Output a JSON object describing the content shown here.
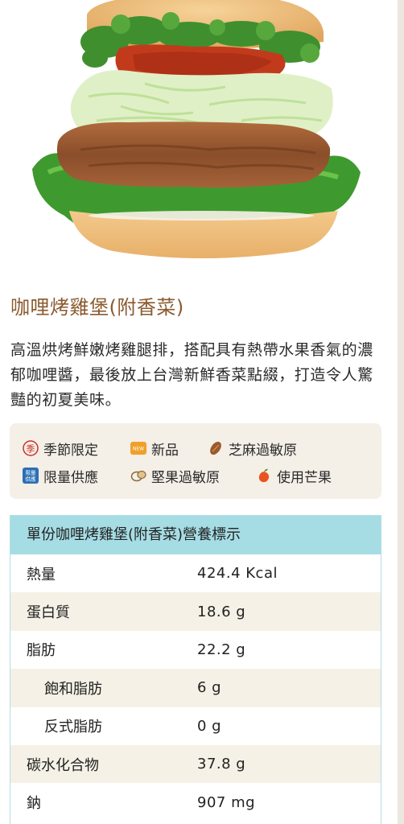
{
  "product": {
    "title": "咖哩烤雞堡(附香菜)",
    "description": "高溫烘烤鮮嫩烤雞腿排，搭配具有熱帶水果香氣的濃郁咖哩醬，最後放上台灣新鮮香菜點綴，打造令人驚豔的初夏美味。"
  },
  "tags": [
    {
      "label": "季節限定",
      "icon": "seasonal-icon"
    },
    {
      "label": "新品",
      "icon": "new-badge-icon"
    },
    {
      "label": "芝麻過敏原",
      "icon": "sesame-icon"
    },
    {
      "label": "限量供應",
      "icon": "limited-supply-icon"
    },
    {
      "label": "堅果過敏原",
      "icon": "nut-icon"
    },
    {
      "label": "使用芒果",
      "icon": "mango-icon"
    }
  ],
  "icon_text": {
    "seasonal": "季",
    "new": "NEW",
    "limited_top": "限量",
    "limited_bottom": "供應"
  },
  "nutrition": {
    "heading": "單份咖哩烤雞堡(附香菜)營養標示",
    "rows": [
      {
        "label": "熱量",
        "value": "424.4 Kcal"
      },
      {
        "label": "蛋白質",
        "value": "18.6 g"
      },
      {
        "label": "脂肪",
        "value": "22.2 g"
      },
      {
        "label": "飽和脂肪",
        "value": "6 g"
      },
      {
        "label": "反式脂肪",
        "value": "0 g"
      },
      {
        "label": "碳水化合物",
        "value": "37.8 g"
      },
      {
        "label": "鈉",
        "value": "907 mg"
      }
    ]
  },
  "colors": {
    "title": "#8a5a2e",
    "tag_box": "#f4efe7",
    "table_header": "#a6dde5",
    "table_alt_row": "#f5f1e6"
  }
}
